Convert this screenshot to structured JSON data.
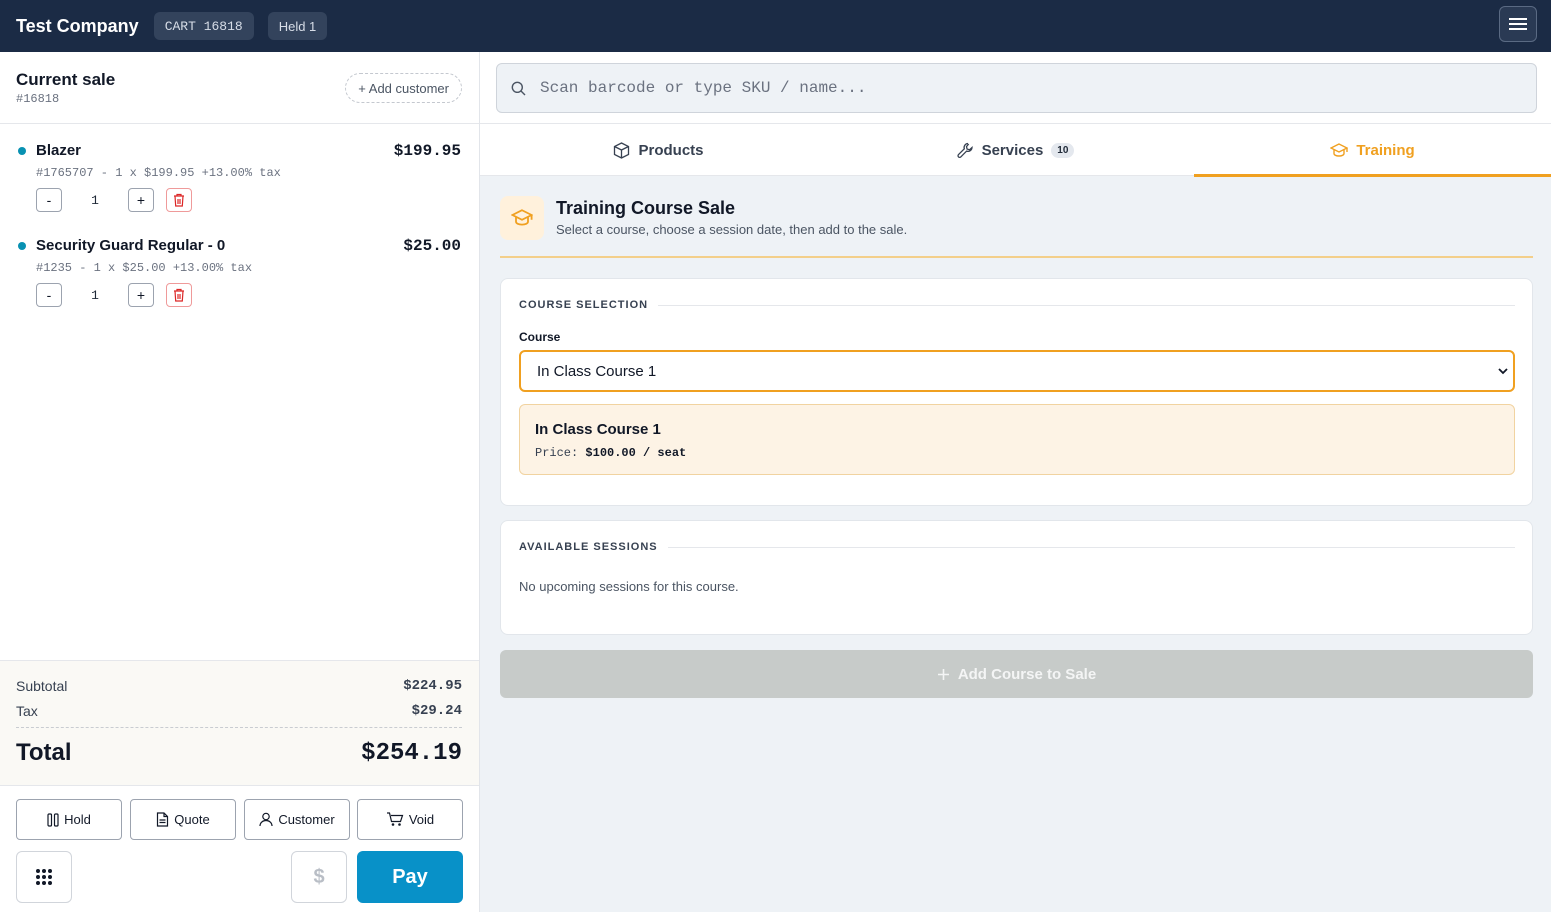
{
  "topbar": {
    "brand": "Test Company",
    "cart_chip": "CART 16818",
    "held_chip": "Held 1"
  },
  "sale": {
    "title": "Current sale",
    "id": "#16818",
    "add_customer": "+ Add customer",
    "items": [
      {
        "name": "Blazer",
        "price": "$199.95",
        "meta": "#1765707 - 1 x $199.95 +13.00% tax",
        "qty": "1",
        "minus": "-",
        "plus": "+"
      },
      {
        "name": "Security Guard Regular - 0",
        "price": "$25.00",
        "meta": "#1235 - 1 x $25.00 +13.00% tax",
        "qty": "1",
        "minus": "-",
        "plus": "+"
      }
    ],
    "subtotal_label": "Subtotal",
    "subtotal": "$224.95",
    "tax_label": "Tax",
    "tax": "$29.24",
    "total_label": "Total",
    "total": "$254.19",
    "actions": {
      "hold": "Hold",
      "quote": "Quote",
      "customer": "Customer",
      "void": "Void"
    },
    "cash_symbol": "$",
    "pay": "Pay"
  },
  "search": {
    "placeholder": "Scan barcode or type SKU / name..."
  },
  "tabs": {
    "products": "Products",
    "services": "Services",
    "services_count": "10",
    "training": "Training"
  },
  "training": {
    "title": "Training Course Sale",
    "subtitle": "Select a course, choose a session date, then add to the sale.",
    "course_section": "COURSE SELECTION",
    "course_label": "Course",
    "course_selected": "In Class Course 1",
    "info_name": "In Class Course 1",
    "info_price_label": "Price:",
    "info_price": "$100.00 / seat",
    "sessions_section": "AVAILABLE SESSIONS",
    "sessions_empty": "No upcoming sessions for this course.",
    "add_button": "Add Course to Sale"
  },
  "colors": {
    "topbar": "#1b2b45",
    "accent": "#f0a020",
    "pay": "#0891c8"
  }
}
